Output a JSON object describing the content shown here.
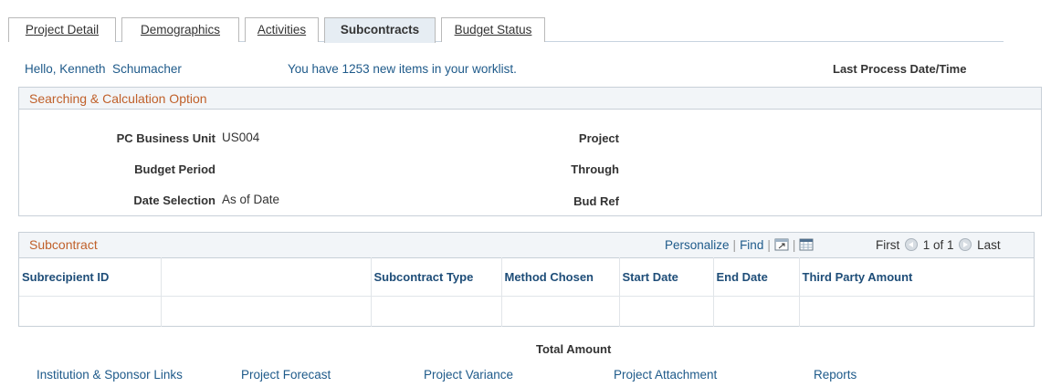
{
  "tabs": [
    {
      "u": "P",
      "rest": "roject Detail"
    },
    {
      "u": "D",
      "rest": "emographics"
    },
    {
      "u": "A",
      "rest": "ctivities"
    },
    {
      "u": "",
      "rest": "Subcontracts"
    },
    {
      "u": "B",
      "rest": "udget Status"
    }
  ],
  "header": {
    "hello": "Hello, Kenneth  Schumacher",
    "worklist": "You have 1253 new items in your worklist.",
    "last_process": "Last Process Date/Time"
  },
  "search": {
    "title": "Searching & Calculation Option",
    "business_unit_label": "PC Business Unit",
    "business_unit_value": "US004",
    "budget_period_label": "Budget Period",
    "date_selection_label": "Date Selection",
    "date_selection_value": "As of Date",
    "project_label": "Project",
    "through_label": "Through",
    "bud_ref_label": "Bud Ref"
  },
  "grid": {
    "title": "Subcontract",
    "personalize": "Personalize",
    "find": "Find",
    "first": "First",
    "page": "1 of 1",
    "last": "Last",
    "columns": [
      "Subrecipient ID",
      "",
      "Subcontract Type",
      "Method Chosen",
      "Start Date",
      "End Date",
      "Third Party Amount"
    ]
  },
  "total_label": "Total Amount",
  "links": [
    "Institution & Sponsor Links",
    "Project Forecast",
    "Project Variance",
    "Project Attachment",
    "Reports"
  ],
  "colors": {
    "link": "#1e5a8a",
    "section_title": "#c0602a",
    "header_bg": "#f2f5f8"
  }
}
